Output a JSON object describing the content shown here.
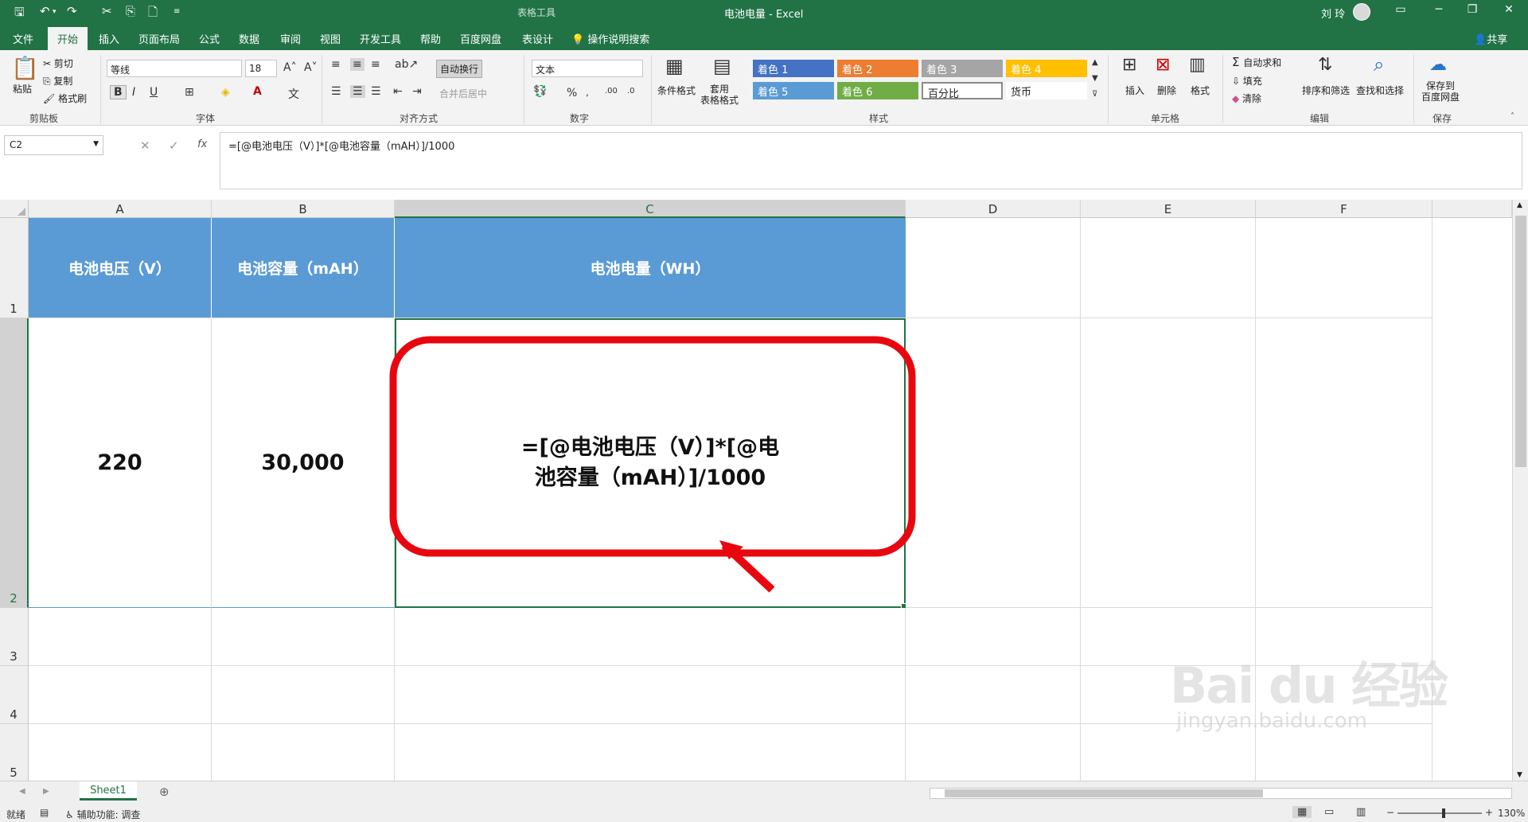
{
  "titlebar": {
    "context_tools": "表格工具",
    "title": "电池电量  -  Excel",
    "user": "刘 玲"
  },
  "tabs": [
    "文件",
    "开始",
    "插入",
    "页面布局",
    "公式",
    "数据",
    "审阅",
    "视图",
    "开发工具",
    "帮助",
    "百度网盘",
    "表设计"
  ],
  "active_tab": "开始",
  "tell_me": "操作说明搜索",
  "share": "共享",
  "ribbon": {
    "clipboard": {
      "paste": "粘贴",
      "cut": "剪切",
      "copy": "复制",
      "format_painter": "格式刷",
      "label": "剪贴板"
    },
    "font": {
      "name": "等线",
      "size": "18",
      "label": "字体",
      "bold": "B",
      "italic": "I",
      "underline": "U"
    },
    "alignment": {
      "wrap": "自动换行",
      "merge": "合并后居中",
      "label": "对齐方式"
    },
    "number": {
      "format": "文本",
      "label": "数字",
      "percent": "%"
    },
    "styles": {
      "conditional": "条件格式",
      "table_format": "套用\n表格格式",
      "cells": [
        "着色 1",
        "着色 2",
        "着色 3",
        "着色 4",
        "着色 5",
        "着色 6",
        "百分比",
        "货币"
      ],
      "label": "样式"
    },
    "cells_group": {
      "insert": "插入",
      "delete": "删除",
      "format": "格式",
      "label": "单元格"
    },
    "editing": {
      "autosum": "自动求和",
      "fill": "填充",
      "clear": "清除",
      "sort": "排序和筛选",
      "find": "查找和选择",
      "label": "编辑"
    },
    "save": {
      "save_to": "保存到\n百度网盘",
      "label": "保存"
    }
  },
  "formula_bar": {
    "name_box": "C2",
    "fx": "fx",
    "formula": "=[@电池电压（V）]*[@电池容量（mAH）]/1000"
  },
  "sheet": {
    "columns": [
      "A",
      "B",
      "C",
      "D",
      "E",
      "F"
    ],
    "rows": [
      "1",
      "2",
      "3",
      "4",
      "5"
    ],
    "header_row": [
      "电池电压（V）",
      "电池容量（mAH）",
      "电池电量（WH）"
    ],
    "data_row": [
      "220",
      "30,000",
      "=[@电池电压（V）]*[@电池容量（mAH）]/1000"
    ],
    "selected_cell": "C2"
  },
  "sheet_tabs": [
    "Sheet1"
  ],
  "status": {
    "ready": "就绪",
    "accessibility": "辅助功能: 调查",
    "zoom": "130%"
  },
  "watermark": "Baidu经验 jingyan.baidu.com",
  "colors": {
    "excel_green": "#217346",
    "header_blue": "#5b9bd5",
    "annotation_red": "#e8070e"
  }
}
